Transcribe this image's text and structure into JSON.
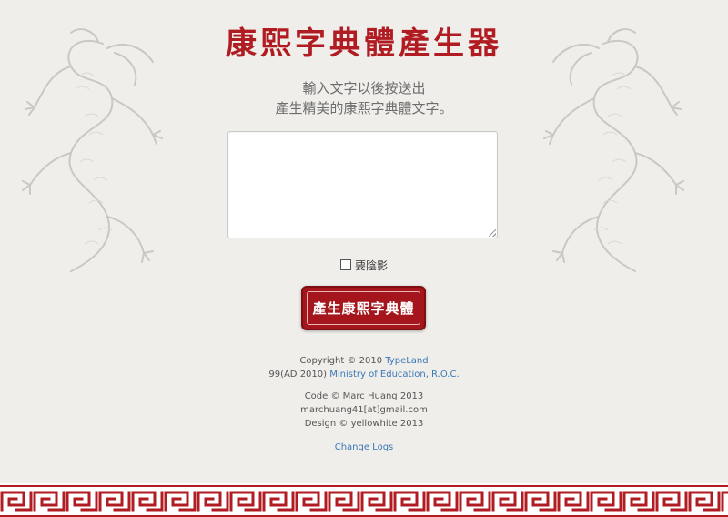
{
  "title": "康熙字典體產生器",
  "instructions": {
    "line1": "輸入文字以後按送出",
    "line2": "產生精美的康熙字典體文字。"
  },
  "textarea": {
    "value": "",
    "placeholder": ""
  },
  "shadow_option": {
    "label": "要陰影",
    "checked": false
  },
  "generate_button": {
    "label": "產生康熙字典體"
  },
  "footer": {
    "copyright_text": "Copyright © 2010",
    "typeland_link": "TypeLand",
    "moe_prefix": "99(AD 2010)",
    "moe_link": "Ministry of Education, R.O.C.",
    "code_credit": "Code © Marc Huang 2013",
    "email": "marchuang41[at]gmail.com",
    "design_credit": "Design © yellowhite 2013",
    "changelog_link": "Change Logs"
  },
  "colors": {
    "background": "#efeeea",
    "brand_red": "#b01c22",
    "link_blue": "#3b78b8"
  },
  "decorations": {
    "dragon_art": "dragon-illustration",
    "border_pattern": "greek-key-fret"
  }
}
